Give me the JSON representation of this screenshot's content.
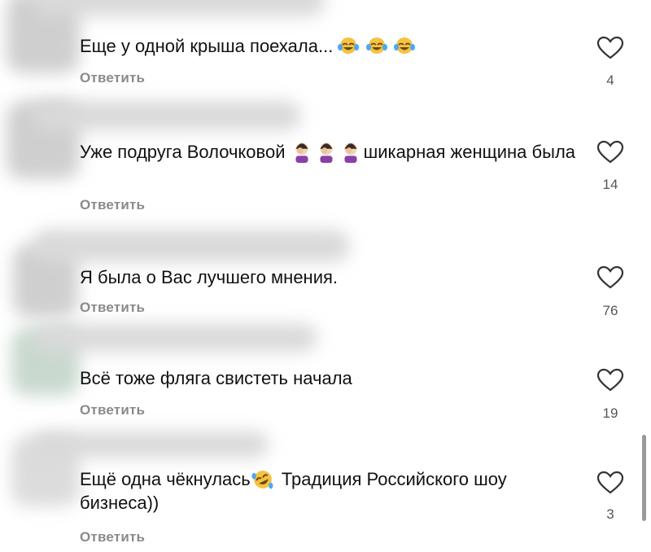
{
  "reply_label": "Ответить",
  "comments": [
    {
      "text": "Еще у одной крыша поехала...",
      "likes": "4"
    },
    {
      "text_before": "Уже подруга Волочковой ",
      "text_after": "шикарная женщина была",
      "likes": "14"
    },
    {
      "text": "Я была о Вас лучшего мнения.",
      "likes": "76"
    },
    {
      "text": "Всё тоже фляга свистеть начала",
      "likes": "19"
    },
    {
      "text_before": "Ещё одна чёкнулась",
      "text_after": " Традиция Российского шоу бизнеса))",
      "likes": "3"
    }
  ],
  "icons": {
    "like": "heart-icon",
    "emoji_1": "face-with-tears-of-joy-icon",
    "emoji_2": "woman-facepalming-icon",
    "emoji_5": "rolling-on-floor-laughing-icon"
  },
  "colors": {
    "text": "#111111",
    "secondary": "#8a8a8a",
    "heart": "#333333"
  }
}
